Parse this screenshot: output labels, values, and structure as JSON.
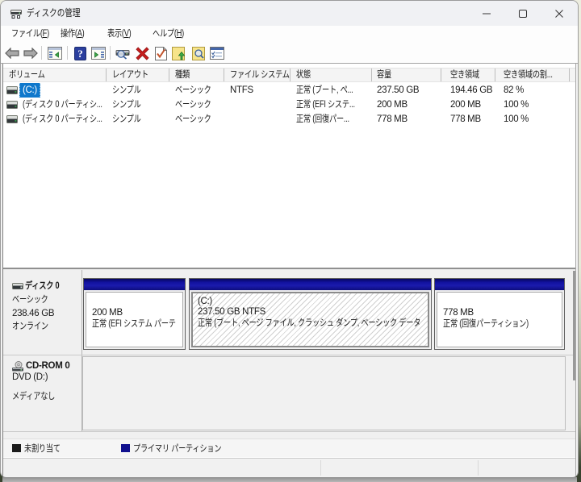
{
  "window": {
    "title": "ディスクの管理",
    "app_icon": "disk-management-icon",
    "controls": [
      {
        "name": "minimize",
        "icon": "minimize-icon"
      },
      {
        "name": "maximize",
        "icon": "maximize-icon"
      },
      {
        "name": "close",
        "icon": "close-icon"
      }
    ]
  },
  "menubar": {
    "items": [
      {
        "name": "file",
        "label": "ファイル(F)"
      },
      {
        "name": "action",
        "label": "操作(A)"
      },
      {
        "name": "view",
        "label": "表示(V)"
      },
      {
        "name": "help",
        "label": "ヘルプ(H)"
      }
    ]
  },
  "toolbar": {
    "buttons": [
      {
        "type": "button",
        "name": "back",
        "icon": "back-arrow-icon"
      },
      {
        "type": "button",
        "name": "forward",
        "icon": "forward-arrow-icon"
      },
      {
        "type": "separator"
      },
      {
        "type": "button",
        "name": "show-console-tree",
        "icon": "console-tree-icon"
      },
      {
        "type": "separator"
      },
      {
        "type": "button",
        "name": "help",
        "icon": "help-icon"
      },
      {
        "type": "button",
        "name": "show-action-pane",
        "icon": "action-pane-icon"
      },
      {
        "type": "separator"
      },
      {
        "type": "button",
        "name": "rescan-disks",
        "icon": "disk-magnifier-icon"
      },
      {
        "type": "button",
        "name": "delete-volume",
        "icon": "delete-cross-icon"
      },
      {
        "type": "button",
        "name": "mark-partition-active",
        "icon": "document-check-icon"
      },
      {
        "type": "button",
        "name": "open",
        "icon": "folder-up-arrow-icon"
      },
      {
        "type": "button",
        "name": "explore",
        "icon": "folder-magnifier-icon"
      },
      {
        "type": "button",
        "name": "properties",
        "icon": "properties-list-icon"
      }
    ]
  },
  "volume_list": {
    "columns": [
      {
        "label": "ボリューム"
      },
      {
        "label": "レイアウト"
      },
      {
        "label": "種類"
      },
      {
        "label": "ファイル システム"
      },
      {
        "label": "状態"
      },
      {
        "label": "容量"
      },
      {
        "label": "空き領域"
      },
      {
        "label": "空き領域の割..."
      },
      {
        "label": ""
      }
    ],
    "rows": [
      {
        "volume": "(C:)",
        "selected": true,
        "cells": [
          "シンプル",
          "ベーシック",
          "NTFS",
          "正常 (ブート, ペ...",
          "237.50 GB",
          "194.46 GB",
          "82 %"
        ]
      },
      {
        "volume": "(ディスク 0 パーティシ...",
        "selected": false,
        "cells": [
          "シンプル",
          "ベーシック",
          "",
          "正常 (EFI システ...",
          "200 MB",
          "200 MB",
          "100 %"
        ]
      },
      {
        "volume": "(ディスク 0 パーティシ...",
        "selected": false,
        "cells": [
          "シンプル",
          "ベーシック",
          "",
          "正常 (回復パー...",
          "778 MB",
          "778 MB",
          "100 %"
        ]
      }
    ]
  },
  "disks": [
    {
      "icon": "hard-disk-icon",
      "name": "ディスク 0",
      "lines": [
        "ベーシック",
        "238.46 GB",
        "オンライン"
      ],
      "partitions": [
        {
          "selected": false,
          "lines": [
            "200 MB",
            "正常 (EFI システム パーテ"
          ]
        },
        {
          "selected": true,
          "lines": [
            "(C:)",
            "237.50 GB NTFS",
            "正常 (ブート, ページ ファイル, クラッシュ ダンプ, ベーシック データ"
          ]
        },
        {
          "selected": false,
          "lines": [
            "778 MB",
            "正常 (回復パーティション)"
          ]
        }
      ]
    },
    {
      "icon": "cd-rom-icon",
      "name": "CD-ROM 0",
      "lines": [
        "DVD (D:)",
        "",
        "メディアなし"
      ],
      "partitions": []
    }
  ],
  "legend": {
    "items": [
      {
        "label": "未割り当て",
        "color": "#1c1c1c"
      },
      {
        "label": "プライマリ パーティション",
        "color": "#10108e"
      }
    ]
  },
  "statusbar": {
    "panes": [
      "",
      "",
      ""
    ]
  },
  "colors": {
    "selection_blue": "#0f78cc",
    "primary_partition_navy": "#10108e",
    "titlebar_bg": "#f0f1f4",
    "pane_bg": "#f0f0f0"
  }
}
